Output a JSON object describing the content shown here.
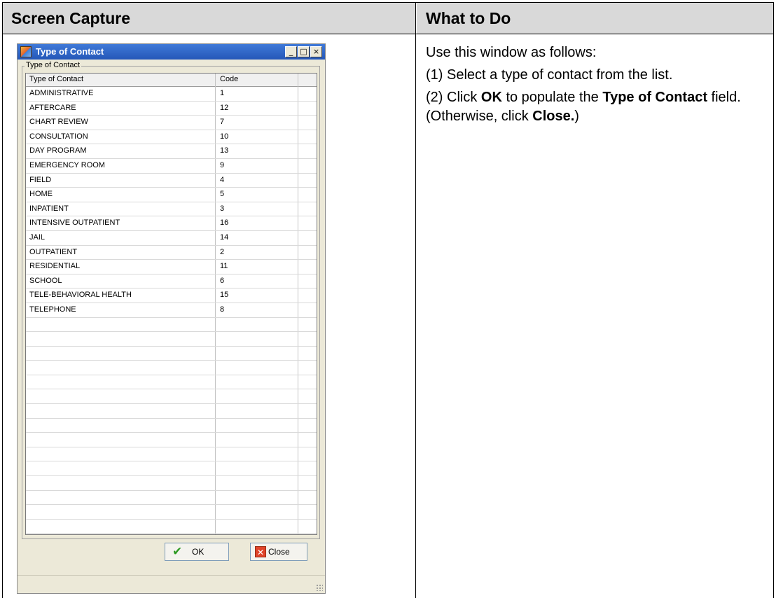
{
  "doc": {
    "col_left_header": "Screen Capture",
    "col_right_header": "What to Do"
  },
  "window": {
    "title": "Type of Contact",
    "title_buttons": {
      "minimize": "_",
      "maximize": "□",
      "close": "×"
    },
    "group_label": "Type of Contact",
    "columns": {
      "name": "Type of Contact",
      "code": "Code"
    },
    "rows": [
      {
        "name": "ADMINISTRATIVE",
        "code": "1"
      },
      {
        "name": "AFTERCARE",
        "code": "12"
      },
      {
        "name": "CHART REVIEW",
        "code": "7"
      },
      {
        "name": "CONSULTATION",
        "code": "10"
      },
      {
        "name": "DAY PROGRAM",
        "code": "13"
      },
      {
        "name": "EMERGENCY ROOM",
        "code": "9"
      },
      {
        "name": "FIELD",
        "code": "4"
      },
      {
        "name": "HOME",
        "code": "5"
      },
      {
        "name": "INPATIENT",
        "code": "3"
      },
      {
        "name": "INTENSIVE OUTPATIENT",
        "code": "16"
      },
      {
        "name": "JAIL",
        "code": "14"
      },
      {
        "name": "OUTPATIENT",
        "code": "2"
      },
      {
        "name": "RESIDENTIAL",
        "code": "11"
      },
      {
        "name": "SCHOOL",
        "code": "6"
      },
      {
        "name": "TELE-BEHAVIORAL HEALTH",
        "code": "15"
      },
      {
        "name": "TELEPHONE",
        "code": "8"
      }
    ],
    "empty_row_count": 15,
    "ok_label": "OK",
    "close_label": "Close",
    "icons": {
      "ok": "checkmark-icon",
      "close": "red-x-icon"
    }
  },
  "instructions": {
    "intro": "Use this window as follows:",
    "step1": "(1) Select a type of contact from the list.",
    "step2_a": "(2) Click ",
    "step2_ok": "OK",
    "step2_b": " to populate the ",
    "step2_field": "Type of Contact",
    "step2_c": " field. (Otherwise, click ",
    "step2_close": "Close.",
    "step2_d": ")"
  }
}
